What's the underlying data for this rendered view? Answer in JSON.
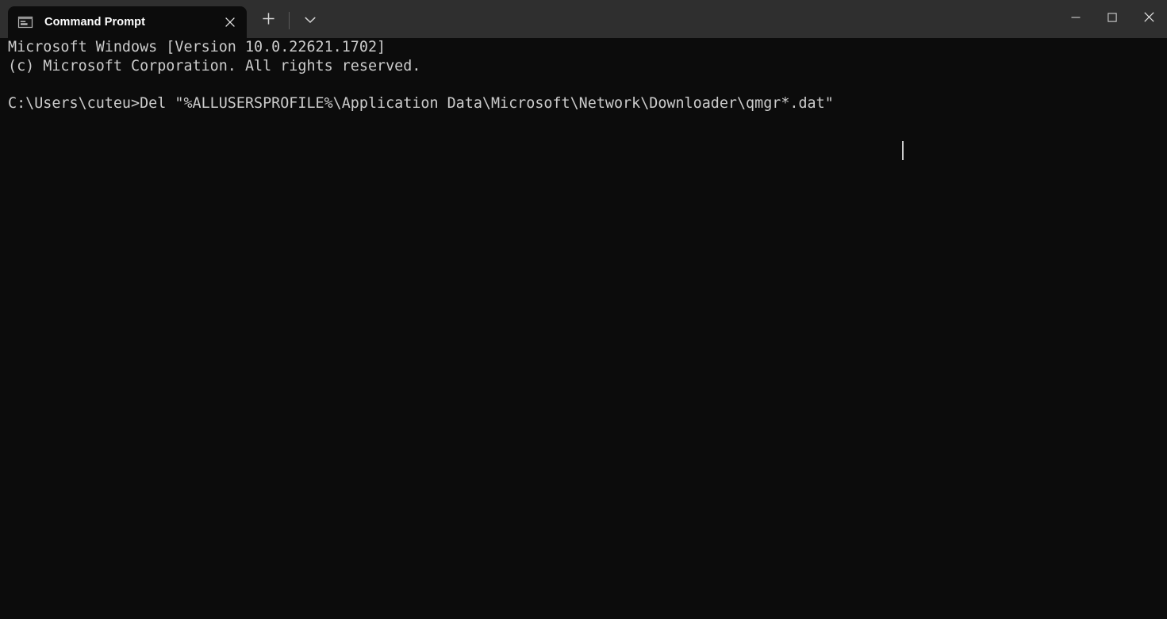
{
  "window": {
    "title": "Command Prompt",
    "colors": {
      "titlebar_bg": "#2f2f2f",
      "tab_active_bg": "#0c0c0c",
      "terminal_bg": "#0c0c0c",
      "terminal_fg": "#cccccc",
      "tab_title_fg": "#ffffff",
      "close_hover": "#c42b1c"
    }
  },
  "tabstrip": {
    "tabs": [
      {
        "label": "Command Prompt",
        "icon": "console-window-icon",
        "active": true,
        "close_icon": "close-icon"
      }
    ],
    "new_tab_icon": "plus-icon",
    "dropdown_icon": "chevron-down-icon"
  },
  "window_controls": {
    "minimize_icon": "minimize-icon",
    "maximize_icon": "maximize-icon",
    "close_icon": "close-icon"
  },
  "terminal": {
    "lines": [
      "Microsoft Windows [Version 10.0.22621.1702]",
      "(c) Microsoft Corporation. All rights reserved.",
      "",
      "C:\\Users\\cuteu>Del \"%ALLUSERSPROFILE%\\Application Data\\Microsoft\\Network\\Downloader\\qmgr*.dat\""
    ],
    "content": "Microsoft Windows [Version 10.0.22621.1702]\n(c) Microsoft Corporation. All rights reserved.\n\nC:\\Users\\cuteu>Del \"%ALLUSERSPROFILE%\\Application Data\\Microsoft\\Network\\Downloader\\qmgr*.dat\"",
    "prompt": "C:\\Users\\cuteu>",
    "command": "Del \"%ALLUSERSPROFILE%\\Application Data\\Microsoft\\Network\\Downloader\\qmgr*.dat\"",
    "os_version": "10.0.22621.1702",
    "cursor_visible": true
  }
}
